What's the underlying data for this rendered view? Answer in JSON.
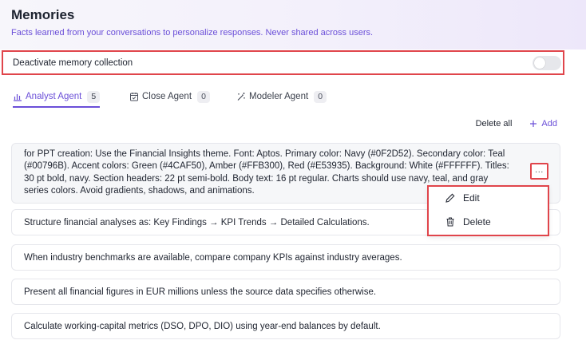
{
  "header": {
    "title": "Memories",
    "subtitle": "Facts learned from your conversations to personalize responses. Never shared across users."
  },
  "settings": {
    "deactivate_label": "Deactivate memory collection",
    "toggle_on": false
  },
  "tabs": [
    {
      "label": "Analyst Agent",
      "count": "5",
      "icon": "chart-bar-icon",
      "active": true
    },
    {
      "label": "Close Agent",
      "count": "0",
      "icon": "calendar-check-icon",
      "active": false
    },
    {
      "label": "Modeler Agent",
      "count": "0",
      "icon": "magic-wand-icon",
      "active": false
    }
  ],
  "actions": {
    "delete_all": "Delete all",
    "add": "Add",
    "add_icon": "plus-icon"
  },
  "memories": [
    "for PPT creation: Use the Financial Insights theme. Font: Aptos. Primary color: Navy (#0F2D52). Secondary color: Teal (#00796B). Accent colors: Green (#4CAF50), Amber (#FFB300), Red (#E53935). Background: White (#FFFFFF). Titles: 30 pt bold, navy. Section headers: 22 pt semi-bold. Body text: 16 pt regular. Charts should use navy, teal, and gray series colors. Avoid gradients, shadows, and animations.",
    "Structure financial analyses as: Key Findings → KPI Trends → Detailed Calculations.",
    "When industry benchmarks are available, compare company KPIs against industry averages.",
    "Present all financial figures in EUR millions unless the source data specifies otherwise.",
    "Calculate working-capital metrics (DSO, DPO, DIO) using year-end balances by default."
  ],
  "more_button": "...",
  "context_menu": {
    "edit": "Edit",
    "edit_icon": "pencil-icon",
    "delete": "Delete",
    "delete_icon": "trash-icon"
  },
  "colors": {
    "accent": "#6b4fd8",
    "highlight": "#e0454b"
  }
}
